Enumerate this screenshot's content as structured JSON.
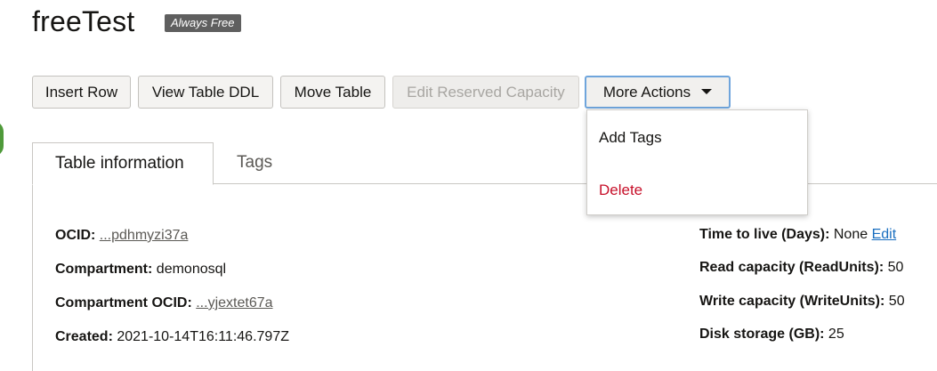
{
  "header": {
    "title": "freeTest",
    "badge": "Always Free"
  },
  "toolbar": {
    "insert_row": "Insert Row",
    "view_table_ddl": "View Table DDL",
    "move_table": "Move Table",
    "edit_reserved_capacity": "Edit Reserved Capacity",
    "more_actions": "More Actions"
  },
  "more_actions_menu": {
    "items": [
      "Add Tags",
      "Delete"
    ]
  },
  "tabs": {
    "table_information": "Table information",
    "tags": "Tags"
  },
  "info_left": {
    "ocid_label": "OCID:",
    "ocid_value": "...pdhmyzi37a",
    "compartment_label": "Compartment:",
    "compartment_value": "demonosql",
    "compartment_ocid_label": "Compartment OCID:",
    "compartment_ocid_value": "...yjextet67a",
    "created_label": "Created:",
    "created_value": "2021-10-14T16:11:46.797Z"
  },
  "info_right": {
    "ttl_label": "Time to live (Days):",
    "ttl_value": "None",
    "ttl_edit": "Edit",
    "read_label": "Read capacity (ReadUnits):",
    "read_value": "50",
    "write_label": "Write capacity (WriteUnits):",
    "write_value": "50",
    "disk_label": "Disk storage (GB):",
    "disk_value": "25"
  },
  "colors": {
    "danger": "#c7102a",
    "link_blue": "#1a6fc0",
    "focus_ring": "#6fa5dc"
  }
}
